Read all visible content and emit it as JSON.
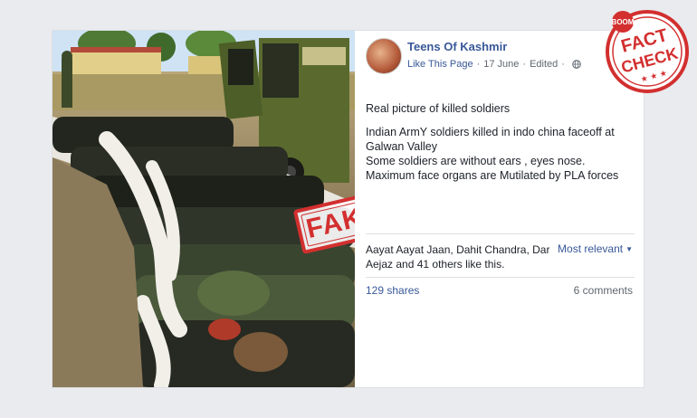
{
  "photo": {
    "stamp_text": "FAKE",
    "stamp_color": "#d32f2f"
  },
  "post": {
    "page_name": "Teens Of Kashmir",
    "like_page": "Like This Page",
    "date": "17 June",
    "edited": "Edited",
    "globe_icon": "globe-icon",
    "text_line_1": "Real picture of killed soldiers",
    "text_line_2": "Indian ArmY soldiers killed in indo china faceoff at Galwan Valley",
    "text_line_3": "Some soldiers are without ears , eyes nose.",
    "text_line_4": "Maximum face organs are Mutilated by PLA forces",
    "likes": "Aayat Aayat Jaan, Dahit Chandra, Dar Aejaz and 41 others like this.",
    "sort_label": "Most relevant",
    "shares": "129 shares",
    "comments": "6 comments",
    "link_color": "#385898"
  },
  "badge": {
    "top": "BOOM",
    "line1": "FACT",
    "line2": "CHECK",
    "color": "#d32f2f"
  }
}
